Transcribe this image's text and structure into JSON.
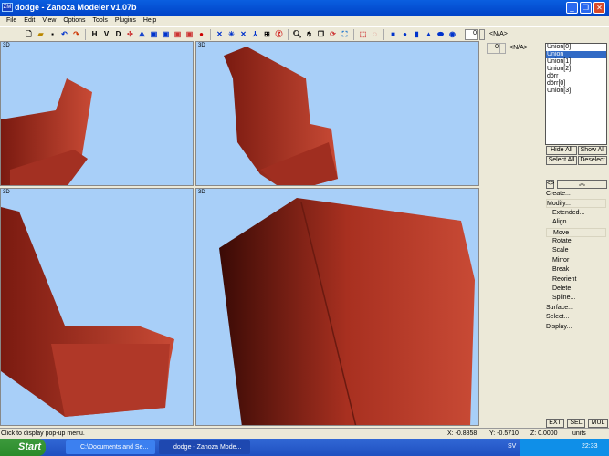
{
  "window": {
    "title": "dodge - Zanoza Modeler v1.07b",
    "icon_text": "ZM",
    "min": "_",
    "max": "❐",
    "close": "✕"
  },
  "menu": [
    "File",
    "Edit",
    "View",
    "Options",
    "Tools",
    "Plugins",
    "Help"
  ],
  "toolbar": {
    "h": "H",
    "v": "V",
    "d": "D",
    "spin_value": "0",
    "na_label": "<N/A>"
  },
  "viewports": [
    {
      "label": "3D"
    },
    {
      "label": "3D"
    },
    {
      "label": "3D"
    },
    {
      "label": "3D"
    }
  ],
  "panel": {
    "spin_value": "0",
    "na_label": "<N/A>",
    "objects": [
      {
        "name": "Union[0]",
        "selected": false
      },
      {
        "name": "Union",
        "selected": true
      },
      {
        "name": "Union[1]",
        "selected": false
      },
      {
        "name": "Union[2]",
        "selected": false
      },
      {
        "name": "dörr",
        "selected": false
      },
      {
        "name": "dörr[0]",
        "selected": false
      },
      {
        "name": "Union[3]",
        "selected": false
      }
    ],
    "hide_all": "Hide All",
    "show_all": "Show All",
    "select_all": "Select All",
    "deselect": "Deselect",
    "collapse": "︽",
    "toggle": "<>",
    "menu": [
      {
        "label": "Create...",
        "indent": 0
      },
      {
        "label": "Modify...",
        "indent": 0,
        "boxed": true
      },
      {
        "label": "Extended...",
        "indent": 1
      },
      {
        "label": "Align...",
        "indent": 1
      },
      {
        "label": "Move",
        "indent": 1,
        "boxed": true
      },
      {
        "label": "Rotate",
        "indent": 1
      },
      {
        "label": "Scale",
        "indent": 1
      },
      {
        "label": "Mirror",
        "indent": 1
      },
      {
        "label": "Break",
        "indent": 1
      },
      {
        "label": "Reorient",
        "indent": 1
      },
      {
        "label": "Delete",
        "indent": 1
      },
      {
        "label": "Spline...",
        "indent": 1
      },
      {
        "label": "Surface...",
        "indent": 0
      },
      {
        "label": "Select...",
        "indent": 0
      },
      {
        "label": "Display...",
        "indent": 0
      }
    ],
    "modes": [
      "EXT",
      "SEL",
      "MUL"
    ]
  },
  "status": {
    "hint": "Click to display pop-up menu.",
    "x": "X: -0.8858",
    "y": "Y: -0.5710",
    "z": "Z: 0.0000",
    "units": "units"
  },
  "taskbar": {
    "start": "Start",
    "tasks": [
      "C:\\Documents and Se...",
      "dodge - Zanoza Mode..."
    ],
    "lang": "SV",
    "clock": "22:33"
  },
  "colors": {
    "viewport_bg": "#a8cff8",
    "model": "#b83a2a",
    "selection": "#316ac5"
  }
}
